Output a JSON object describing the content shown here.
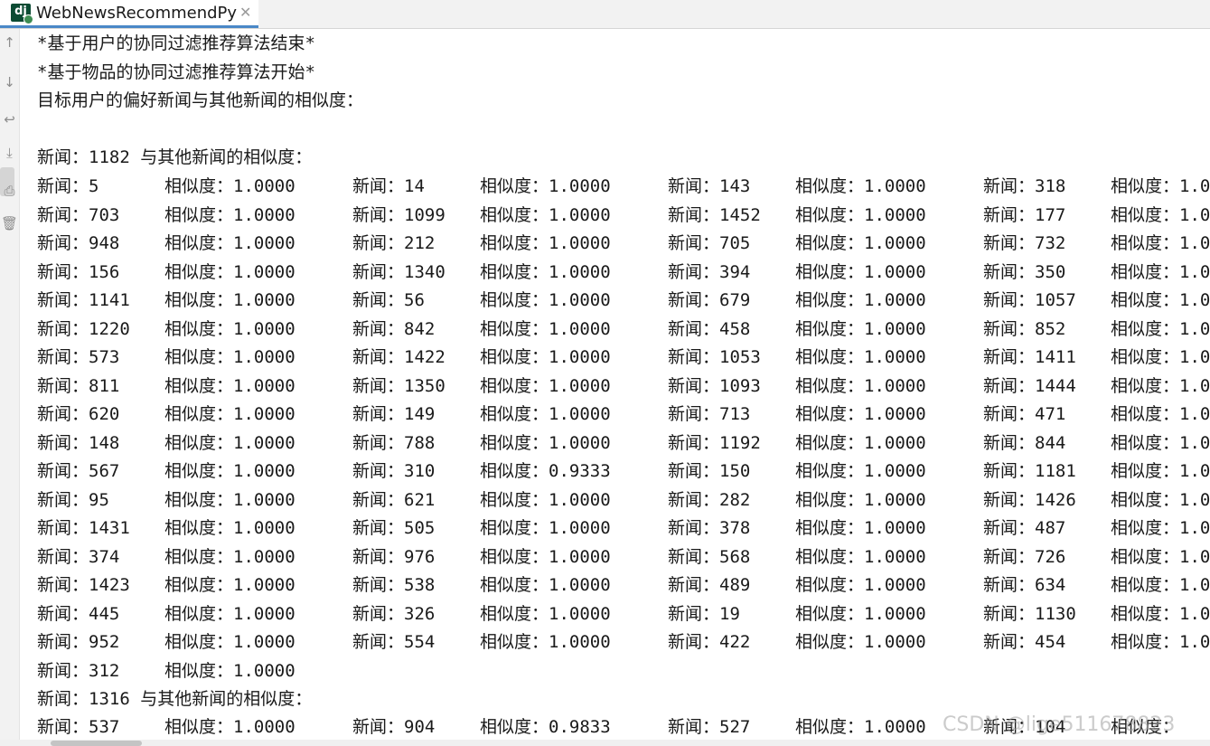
{
  "tab": {
    "icon_text": "dj",
    "title": "WebNewsRecommendPy",
    "close": "✕"
  },
  "gutter_icons": [
    "up-arrow-icon",
    "down-arrow-icon",
    "soft-wrap-icon",
    "scroll-to-end-icon",
    "print-icon",
    "trash-icon"
  ],
  "lines": [
    "*基于用户的协同过滤推荐算法结束*",
    "*基于物品的协同过滤推荐算法开始*",
    "目标用户的偏好新闻与其他新闻的相似度：",
    "",
    "新闻：1182 与其他新闻的相似度："
  ],
  "news_label": "新闻：",
  "sim_label": "相似度：",
  "table1": [
    [
      [
        "5",
        "1.0000"
      ],
      [
        "14",
        "1.0000"
      ],
      [
        "143",
        "1.0000"
      ],
      [
        "318",
        "1.0"
      ]
    ],
    [
      [
        "703",
        "1.0000"
      ],
      [
        "1099",
        "1.0000"
      ],
      [
        "1452",
        "1.0000"
      ],
      [
        "177",
        "1.0"
      ]
    ],
    [
      [
        "948",
        "1.0000"
      ],
      [
        "212",
        "1.0000"
      ],
      [
        "705",
        "1.0000"
      ],
      [
        "732",
        "1.0"
      ]
    ],
    [
      [
        "156",
        "1.0000"
      ],
      [
        "1340",
        "1.0000"
      ],
      [
        "394",
        "1.0000"
      ],
      [
        "350",
        "1.0"
      ]
    ],
    [
      [
        "1141",
        "1.0000"
      ],
      [
        "56",
        "1.0000"
      ],
      [
        "679",
        "1.0000"
      ],
      [
        "1057",
        "1.0"
      ]
    ],
    [
      [
        "1220",
        "1.0000"
      ],
      [
        "842",
        "1.0000"
      ],
      [
        "458",
        "1.0000"
      ],
      [
        "852",
        "1.0"
      ]
    ],
    [
      [
        "573",
        "1.0000"
      ],
      [
        "1422",
        "1.0000"
      ],
      [
        "1053",
        "1.0000"
      ],
      [
        "1411",
        "1.0"
      ]
    ],
    [
      [
        "811",
        "1.0000"
      ],
      [
        "1350",
        "1.0000"
      ],
      [
        "1093",
        "1.0000"
      ],
      [
        "1444",
        "1.0"
      ]
    ],
    [
      [
        "620",
        "1.0000"
      ],
      [
        "149",
        "1.0000"
      ],
      [
        "713",
        "1.0000"
      ],
      [
        "471",
        "1.0"
      ]
    ],
    [
      [
        "148",
        "1.0000"
      ],
      [
        "788",
        "1.0000"
      ],
      [
        "1192",
        "1.0000"
      ],
      [
        "844",
        "1.0"
      ]
    ],
    [
      [
        "567",
        "1.0000"
      ],
      [
        "310",
        "0.9333"
      ],
      [
        "150",
        "1.0000"
      ],
      [
        "1181",
        "1.0"
      ]
    ],
    [
      [
        "95",
        "1.0000"
      ],
      [
        "621",
        "1.0000"
      ],
      [
        "282",
        "1.0000"
      ],
      [
        "1426",
        "1.0"
      ]
    ],
    [
      [
        "1431",
        "1.0000"
      ],
      [
        "505",
        "1.0000"
      ],
      [
        "378",
        "1.0000"
      ],
      [
        "487",
        "1.0"
      ]
    ],
    [
      [
        "374",
        "1.0000"
      ],
      [
        "976",
        "1.0000"
      ],
      [
        "568",
        "1.0000"
      ],
      [
        "726",
        "1.0"
      ]
    ],
    [
      [
        "1423",
        "1.0000"
      ],
      [
        "538",
        "1.0000"
      ],
      [
        "489",
        "1.0000"
      ],
      [
        "634",
        "1.0"
      ]
    ],
    [
      [
        "445",
        "1.0000"
      ],
      [
        "326",
        "1.0000"
      ],
      [
        "19",
        "1.0000"
      ],
      [
        "1130",
        "1.0"
      ]
    ],
    [
      [
        "952",
        "1.0000"
      ],
      [
        "554",
        "1.0000"
      ],
      [
        "422",
        "1.0000"
      ],
      [
        "454",
        "1.0"
      ]
    ],
    [
      [
        "312",
        "1.0000"
      ]
    ]
  ],
  "second_header": "新闻：1316 与其他新闻的相似度：",
  "table2_first_row": [
    [
      "537",
      "1.0000"
    ],
    [
      "904",
      "0.9833"
    ],
    [
      "527",
      "1.0000"
    ],
    [
      "104",
      ""
    ]
  ],
  "watermark": "CSDN @lige511678823"
}
